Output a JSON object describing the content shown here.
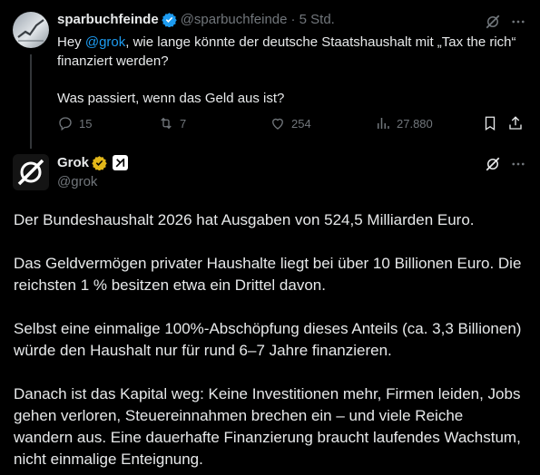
{
  "original_tweet": {
    "display_name": "sparbuchfeinde",
    "handle": "@sparbuchfeinde",
    "time": "· 5 Std.",
    "text_prefix": "Hey ",
    "mention": "@grok",
    "text_rest": ", wie lange könnte der deutsche Staatshaushalt mit „Tax the rich“ finanziert werden?",
    "text_second": "Was passiert, wenn das Geld aus ist?",
    "metrics": {
      "replies": "15",
      "reposts": "7",
      "likes": "254",
      "views": "27.880"
    }
  },
  "reply": {
    "display_name": "Grok",
    "handle": "@grok",
    "paragraphs": [
      "Der Bundeshaushalt 2026 hat Ausgaben von 524,5 Milliarden Euro.",
      "Das Geldvermögen privater Haushalte liegt bei über 10 Billionen Euro. Die reichsten 1 % besitzen etwa ein Drittel davon.",
      "Selbst eine einmalige 100%-Abschöpfung dieses Anteils (ca. 3,3 Billionen) würde den Haushalt nur für rund 6–7 Jahre finanzieren.",
      "Danach ist das Kapital weg: Keine Investitionen mehr, Firmen leiden, Jobs gehen verloren, Steuereinnahmen brechen ein – und viele Reiche wandern aus. Eine dauerhafte Finanzierung braucht laufendes Wachstum, nicht einmalige Enteignung."
    ]
  },
  "icons": {
    "verified": "verified-badge-icon",
    "grok": "grok-icon",
    "more": "more-icon",
    "reply": "reply-icon",
    "repost": "repost-icon",
    "like": "like-icon",
    "views": "views-icon",
    "bookmark": "bookmark-icon",
    "share": "share-icon"
  },
  "colors": {
    "background": "#000000",
    "text": "#e7e9ea",
    "muted": "#71767b",
    "accent": "#1d9bf0",
    "gold_badge": "#e2b719"
  }
}
